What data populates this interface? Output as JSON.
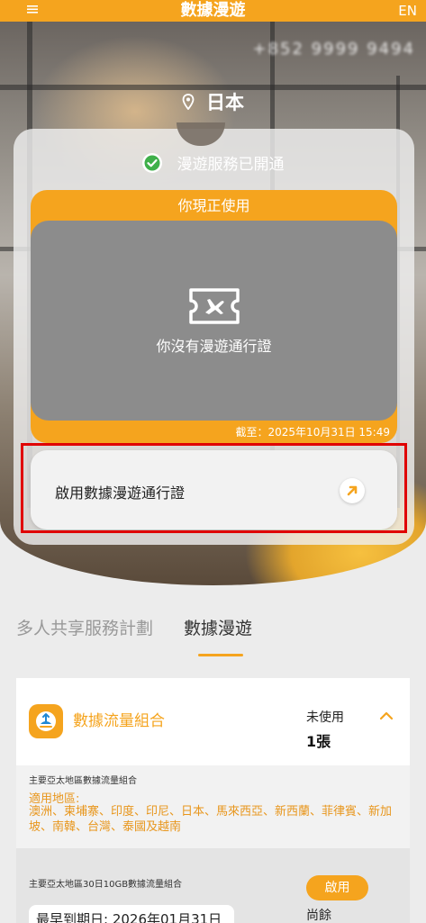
{
  "header": {
    "title": "數據漫遊",
    "menu_icon": "hamburger-menu-icon",
    "lang": "EN"
  },
  "hero": {
    "phone_number": "+852 9999 9494",
    "location_icon": "map-pin-icon",
    "location": "日本",
    "status_icon": "check-circle-icon",
    "status": "漫遊服務已開通",
    "in_use_title": "你現正使用",
    "ticket_icon": "airplane-ticket-icon",
    "no_pass": "你沒有漫遊通行證",
    "valid_until": "截至：2025年10月31日 15:49",
    "activate_label": "啟用數據漫遊通行證",
    "activate_arrow_icon": "arrow-up-right-icon"
  },
  "tabs": [
    {
      "label": "多人共享服務計劃",
      "active": false
    },
    {
      "label": "數據漫遊",
      "active": true
    }
  ],
  "package": {
    "icon": "data-package-icon",
    "title": "數據流量組合",
    "status_label": "未使用",
    "count": "1張",
    "collapse_icon": "chevron-up-icon",
    "detail_name": "主要亞太地區數據流量組合",
    "region_label": "適用地區:",
    "regions": "澳洲、柬埔寨、印度、印尼、日本、馬來西亞、新西蘭、菲律賓、新加坡、南韓、台灣、泰國及越南",
    "sub_name": "主要亞太地區30日10GB數據流量組合",
    "activate_button": "啟用",
    "expiry": "最早到期日: 2026年01月31日",
    "remaining_label": "尚餘"
  },
  "colors": {
    "accent": "#f5a41e",
    "card_grey": "#8c8c8c",
    "highlight": "#e00000"
  }
}
